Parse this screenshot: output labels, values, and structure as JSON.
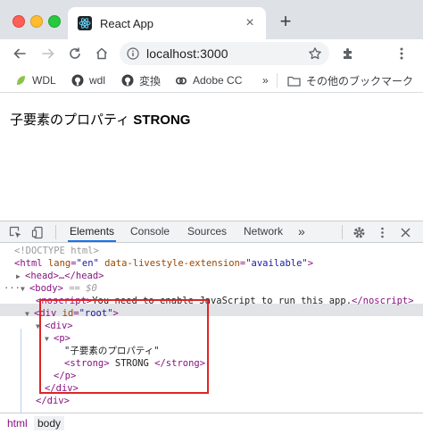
{
  "browser": {
    "tab_title": "React App",
    "url": "localhost:3000"
  },
  "bookmarks": [
    {
      "label": "WDL"
    },
    {
      "label": "wdl"
    },
    {
      "label": "変換"
    },
    {
      "label": "Adobe CC"
    },
    {
      "label": "その他のブックマーク"
    }
  ],
  "bookmarks_overflow": "»",
  "page": {
    "text": "子要素のプロパティ",
    "strong": "STRONG"
  },
  "devtools": {
    "tabs": [
      "Elements",
      "Console",
      "Sources",
      "Network"
    ],
    "overflow": "»",
    "active_tab": "Elements",
    "dom": {
      "doctype": "<!DOCTYPE html>",
      "html_open": "<html",
      "html_attr1_name": " lang",
      "html_attr1_val": "\"en\"",
      "html_attr2_name": " data-livestyle-extension",
      "html_attr2_val": "\"available\"",
      "gt": ">",
      "head": "<head>…</head>",
      "body_open": "<body>",
      "body_marker": " == $0",
      "ellipsis": "···",
      "noscript_open": "<noscript>",
      "noscript_text": "You need to enable JavaScript to run this app.",
      "noscript_close": "</noscript>",
      "div_root_open": "<div",
      "div_root_attr": " id",
      "div_root_val": "\"root\"",
      "div_open": "<div>",
      "p_open": "<p>",
      "p_text": "\"子要素のプロパティ\"",
      "strong_open": "<strong>",
      "strong_text": " STRONG ",
      "strong_close": "</strong>",
      "p_close": "</p>",
      "div_close": "</div>",
      "div_root_close": "</div>"
    },
    "breadcrumbs": [
      "html",
      "body"
    ]
  },
  "colors": {
    "tag": "#881280",
    "attribute": "#994500",
    "value": "#1a1aa6",
    "highlight_box": "#e02424",
    "active_tab_underline": "#1a73e8"
  }
}
